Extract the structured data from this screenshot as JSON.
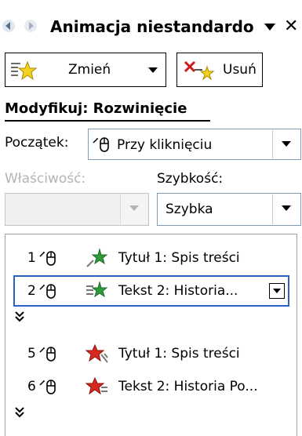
{
  "pane": {
    "title": "Animacja niestandardo",
    "nav_back_icon": "back-arrow-icon",
    "nav_forward_icon": "forward-arrow-icon",
    "close_glyph": "✕"
  },
  "toolbar": {
    "change_label": "Zmień",
    "remove_label": "Usuń"
  },
  "modify": {
    "heading": "Modyfikuj: Rozwinięcie",
    "start_label": "Początek:",
    "start_value": "Przy kliknięciu",
    "property_label": "Właściwość:",
    "property_value": "",
    "speed_label": "Szybkość:",
    "speed_value": "Szybka"
  },
  "effects": [
    {
      "num": "1",
      "text": "Tytuł 1: Spis treści",
      "icon": "green-star-entrance-icon"
    },
    {
      "num": "2",
      "text": "Tekst 2: Historia...",
      "icon": "green-star-entrance-icon",
      "selected": true
    },
    {
      "num": "5",
      "text": "Tytuł 1: Spis treści",
      "icon": "red-star-exit-icon"
    },
    {
      "num": "6",
      "text": "Tekst 2: Historia Po...",
      "icon": "red-star-exit-icon"
    }
  ],
  "colors": {
    "selection_border": "#2a62c6",
    "entrance_green": "#2e9b3a",
    "exit_red": "#d9281e"
  }
}
